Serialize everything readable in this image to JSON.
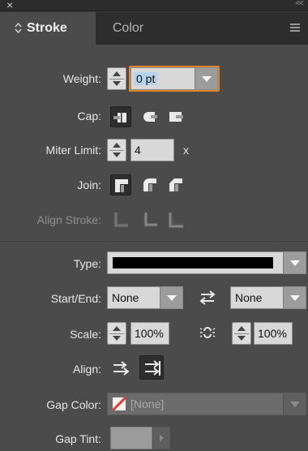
{
  "panel": {
    "close_glyph": "×",
    "collapse_glyph": "<<",
    "tabs": [
      {
        "label": "Stroke",
        "active": true
      },
      {
        "label": "Color",
        "active": false
      }
    ],
    "menu_icon": "panel-menu-icon"
  },
  "weight": {
    "label": "Weight:",
    "value": "0 pt"
  },
  "cap": {
    "label": "Cap:",
    "options": [
      "butt-cap",
      "round-cap",
      "projecting-cap"
    ],
    "selected": 0
  },
  "miter": {
    "label": "Miter Limit:",
    "value": "4",
    "suffix": "x"
  },
  "join": {
    "label": "Join:",
    "options": [
      "miter-join",
      "round-join",
      "bevel-join"
    ],
    "selected": 0
  },
  "align_stroke": {
    "label": "Align Stroke:",
    "options": [
      "center",
      "inside",
      "outside"
    ],
    "enabled": false
  },
  "type": {
    "label": "Type:",
    "value": "solid-line"
  },
  "start_end": {
    "label": "Start/End:",
    "start": "None",
    "end": "None"
  },
  "scale": {
    "label": "Scale:",
    "start": "100%",
    "end": "100%"
  },
  "align": {
    "label": "Align:",
    "options": [
      "extend-beyond-path",
      "place-at-path-end"
    ],
    "selected": 1
  },
  "gap_color": {
    "label": "Gap Color:",
    "value": "[None]"
  },
  "gap_tint": {
    "label": "Gap Tint:",
    "value": ""
  },
  "colors": {
    "panel_bg": "#4b4b4b",
    "focus_outline": "#e0862a",
    "field_bg": "#d8d8d8",
    "none_swatch": "#e53a2f"
  }
}
